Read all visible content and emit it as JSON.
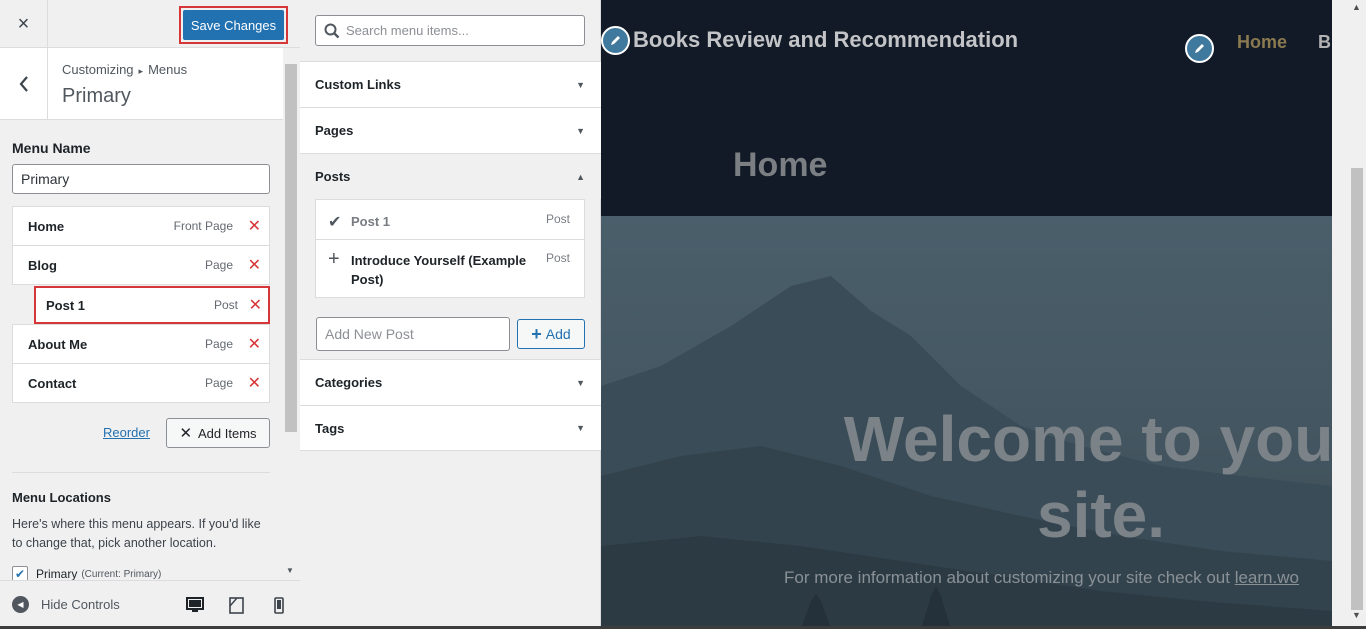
{
  "topbar": {
    "close_icon": "×",
    "save_label": "Save Changes"
  },
  "section_header": {
    "crumb_root": "Customizing",
    "crumb_separator": "▸",
    "crumb_parent": "Menus",
    "title": "Primary"
  },
  "menu_name": {
    "label": "Menu Name",
    "value": "Primary"
  },
  "menu_items": [
    {
      "label": "Home",
      "type": "Front Page"
    },
    {
      "label": "Blog",
      "type": "Page"
    },
    {
      "label": "Post 1",
      "type": "Post"
    },
    {
      "label": "About Me",
      "type": "Page"
    },
    {
      "label": "Contact",
      "type": "Page"
    }
  ],
  "menu_actions": {
    "reorder": "Reorder",
    "add_items": "Add Items",
    "delete_icon": "✕"
  },
  "menu_locations": {
    "title": "Menu Locations",
    "desc": "Here's where this menu appears. If you'd like to change that, pick another location.",
    "primary_label": "Primary",
    "primary_note": "(Current: Primary)",
    "primary_checked": true
  },
  "footer": {
    "hide_controls": "Hide Controls"
  },
  "available": {
    "search_placeholder": "Search menu items...",
    "sections": [
      {
        "label": "Custom Links",
        "open": false
      },
      {
        "label": "Pages",
        "open": false
      },
      {
        "label": "Posts",
        "open": true
      },
      {
        "label": "Categories",
        "open": false
      },
      {
        "label": "Tags",
        "open": false
      }
    ],
    "posts": [
      {
        "title": "Post 1",
        "type": "Post",
        "added": true,
        "icon": "✔"
      },
      {
        "title": "Introduce Yourself (Example Post)",
        "type": "Post",
        "added": false,
        "icon": "+"
      }
    ],
    "new_post_placeholder": "Add New Post",
    "add_label": "Add"
  },
  "preview": {
    "site_title": "Books Review and Recommendation",
    "nav_home": "Home",
    "nav_blog": "Bl",
    "page_title": "Home",
    "welcome_line1": "Welcome to your",
    "welcome_line2": "site.",
    "sub_text": "For more information about customizing your site check out ",
    "sub_link": "learn.wo",
    "colors": {
      "header_bg": "#111a26",
      "nav_active": "#8a7a50",
      "accent": "#2271b1",
      "danger": "#d63638"
    }
  }
}
